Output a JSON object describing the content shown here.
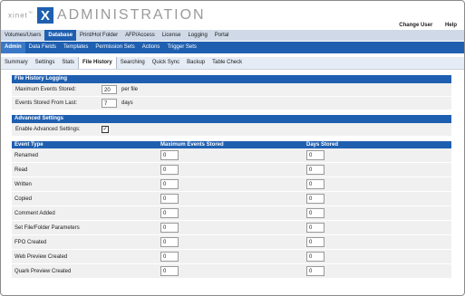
{
  "header": {
    "brand": "xinet",
    "logo_letter": "X",
    "title": "ADMINISTRATION"
  },
  "toplinks": [
    "Change User",
    "Help"
  ],
  "nav1": [
    "Volumes/Users",
    "Database",
    "Print/Hot Folder",
    "AFP/Access",
    "License",
    "Logging",
    "Portal"
  ],
  "nav1_active": 1,
  "nav2": [
    "Admin",
    "Data Fields",
    "Templates",
    "Permission Sets",
    "Actions",
    "Trigger Sets"
  ],
  "nav2_active": 0,
  "nav3": [
    "Summary",
    "Settings",
    "Stats",
    "File History",
    "Searching",
    "Quick Sync",
    "Backup",
    "Table Check"
  ],
  "nav3_active": 3,
  "file_history_logging": {
    "heading": "File History Logging",
    "max_events_label": "Maximum Events Stored:",
    "max_events_value": "20",
    "max_events_unit": "per file",
    "stored_from_label": "Events Stored From Last:",
    "stored_from_value": "7",
    "stored_from_unit": "days"
  },
  "advanced": {
    "heading": "Advanced Settings",
    "enable_label": "Enable Advanced Settings:",
    "enable_checked": "✓"
  },
  "events_table": {
    "headers": [
      "Event Type",
      "Maximum Events Stored",
      "Days Stored"
    ],
    "rows": [
      {
        "type": "Renamed",
        "max": "0",
        "days": "0"
      },
      {
        "type": "Read",
        "max": "0",
        "days": "0"
      },
      {
        "type": "Written",
        "max": "0",
        "days": "0"
      },
      {
        "type": "Copied",
        "max": "0",
        "days": "0"
      },
      {
        "type": "Comment Added",
        "max": "0",
        "days": "0"
      },
      {
        "type": "Set File/Folder Parameters",
        "max": "0",
        "days": "0"
      },
      {
        "type": "FPO Created",
        "max": "0",
        "days": "0"
      },
      {
        "type": "Web Preview Created",
        "max": "0",
        "days": "0"
      },
      {
        "type": "Quark Preview Created",
        "max": "0",
        "days": "0"
      }
    ]
  },
  "colors": {
    "accent": "#1f5fb0",
    "nav_light": "#cfd9e8",
    "row_bg": "#f0f0f0"
  }
}
